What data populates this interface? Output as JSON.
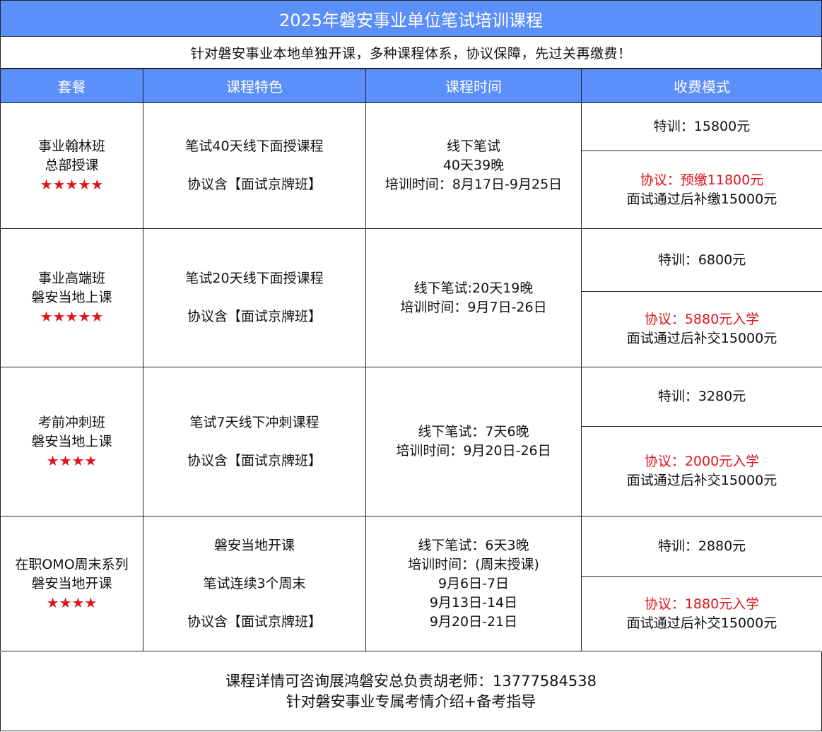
{
  "title": "2025年磐安事业单位笔试培训课程",
  "subtitle": "针对磐安事业本地单独开课，多种课程体系，协议保障，先过关再缴费！",
  "headers": [
    "套餐",
    "课程特色",
    "课程时间",
    "收费模式"
  ],
  "rows": [
    {
      "package": [
        "事业翰林班",
        "总部授课"
      ],
      "stars": "★★★★★",
      "features": [
        "笔试40天线下面授课程",
        "协议含【面试京牌班】"
      ],
      "time": [
        "线下笔试",
        "40天39晚",
        "培训时间：8月17日-9月25日"
      ],
      "fee_special": "特训：15800元",
      "fee_agreement": "协议：预缴11800元",
      "fee_note": "面试通过后补缴15000元"
    },
    {
      "package": [
        "事业高端班",
        "磐安当地上课"
      ],
      "stars": "★★★★★",
      "features": [
        "笔试20天线下面授课程",
        "协议含【面试京牌班】"
      ],
      "time": [
        "线下笔试:20天19晚",
        "培训时间：9月7日-26日"
      ],
      "fee_special": "特训：6800元",
      "fee_agreement": "协议：5880元入学",
      "fee_note": "面试通过后补交15000元"
    },
    {
      "package": [
        "考前冲刺班",
        "磐安当地上课"
      ],
      "stars": "★★★★",
      "features": [
        "笔试7天线下冲刺课程",
        "协议含【面试京牌班】"
      ],
      "time": [
        "线下笔试：7天6晚",
        "培训时间：9月20日-26日"
      ],
      "fee_special": "特训：3280元",
      "fee_agreement": "协议：2000元入学",
      "fee_note": "面试通过后补交15000元"
    },
    {
      "package": [
        "在职OMO周末系列",
        "磐安当地开课"
      ],
      "stars": "★★★★",
      "features": [
        "磐安当地开课",
        "笔试连续3个周末",
        "协议含【面试京牌班】"
      ],
      "time": [
        "线下笔试：6天3晚",
        "培训时间：(周末授课)",
        "9月6日-7日",
        "9月13日-14日",
        "9月20日-21日"
      ],
      "fee_special": "特训：2880元",
      "fee_agreement": "协议：1880元入学",
      "fee_note": "面试通过后补交15000元"
    }
  ],
  "footer": [
    "课程详情可咨询展鸿磐安总负责胡老师：13777584538",
    "针对磐安事业专属考情介绍+备考指导"
  ],
  "colors": {
    "header_bg": "#5b8ff9",
    "accent_red": "#e0131b"
  }
}
